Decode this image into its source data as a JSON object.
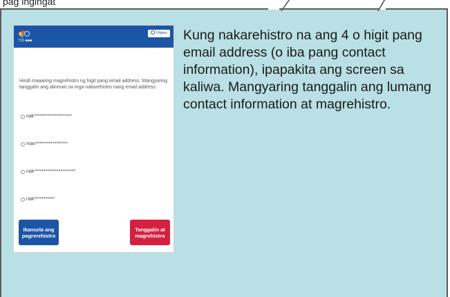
{
  "top_caption": "pag ingingat",
  "screen": {
    "logo_text": "715 ■■■",
    "language_button": "Filipino",
    "message": "Hindi maaaring magrehistro ng higit pang email address. Mangyaring tanggalin ang alinman sa mga nakarehistro nang email address.",
    "options": [
      "nak********************",
      "man*****************",
      "nak**********************",
      "nak***********"
    ],
    "cancel_button": "Ikansela ang pagrerehistro",
    "delete_button": "Tanggalin at magrehistro",
    "colors": {
      "header": "#1d55a6",
      "cancel": "#1d55a6",
      "delete": "#d6203f"
    }
  },
  "description": "Kung nakarehistro na ang 4 o higit pang email address (o iba pang contact information), ipapakita ang screen sa kaliwa. Mangyaring tanggalin ang lumang contact information at magrehistro.",
  "colors": {
    "panel_background": "#b9e0e4",
    "panel_border": "#5a5a5a"
  }
}
